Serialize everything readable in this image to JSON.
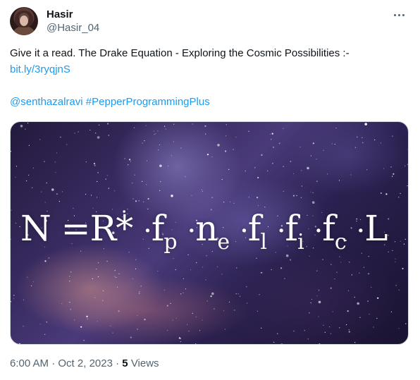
{
  "author": {
    "display_name": "Hasir",
    "handle": "@Hasir_04"
  },
  "tweet": {
    "text_line1": "Give it a read. The Drake Equation - Exploring the Cosmic Possibilities :-",
    "link": "bit.ly/3ryqjnS",
    "mention": "@senthazalravi",
    "hashtag": "#PepperProgrammingPlus"
  },
  "media": {
    "equation": {
      "n": "N",
      "eq": "=",
      "r": "R*",
      "f1": "f",
      "f1_sub": "p",
      "n2": "n",
      "n2_sub": "e",
      "f2": "f",
      "f2_sub": "l",
      "f3": "f",
      "f3_sub": "i",
      "f4": "f",
      "f4_sub": "c",
      "l": "L",
      "dot": "·"
    }
  },
  "meta": {
    "time": "6:00 AM",
    "sep": "·",
    "date": "Oct 2, 2023",
    "views_count": "5",
    "views_label": "Views"
  },
  "icons": {
    "more": "more-horizontal-icon"
  },
  "colors": {
    "link": "#1d9bf0",
    "secondary_text": "#536471",
    "primary_text": "#0f1419"
  }
}
